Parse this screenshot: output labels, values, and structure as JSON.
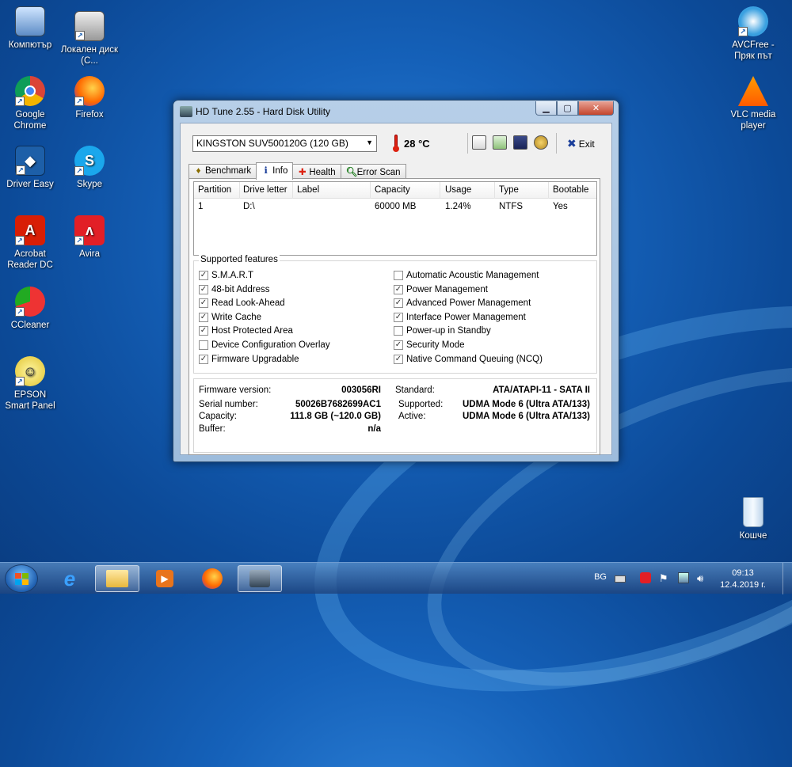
{
  "desktop_icons": [
    {
      "label": "Компютър"
    },
    {
      "label": "Локален диск (C..."
    },
    {
      "label": "Google Chrome"
    },
    {
      "label": "Firefox"
    },
    {
      "label": "Driver Easy"
    },
    {
      "label": "Skype"
    },
    {
      "label": "Acrobat Reader DC"
    },
    {
      "label": "Avira"
    },
    {
      "label": "CCleaner"
    },
    {
      "label": "EPSON Smart Panel"
    },
    {
      "label": "AVCFree - Пряк път"
    },
    {
      "label": "VLC media player"
    },
    {
      "label": "Кошче"
    }
  ],
  "window": {
    "title": "HD Tune 2.55 - Hard Disk Utility",
    "drive": "KINGSTON SUV500120G (120 GB)",
    "temperature": "28 °C",
    "exit_label": "Exit"
  },
  "tabs": [
    {
      "label": "Benchmark",
      "icon": "benchmark-icon"
    },
    {
      "label": "Info",
      "icon": "info-icon",
      "active": true
    },
    {
      "label": "Health",
      "icon": "health-icon"
    },
    {
      "label": "Error Scan",
      "icon": "error-scan-icon"
    }
  ],
  "partition_table": {
    "columns": [
      "Partition",
      "Drive letter",
      "Label",
      "Capacity",
      "Usage",
      "Type",
      "Bootable"
    ],
    "rows": [
      [
        "1",
        "D:\\",
        "",
        "60000 MB",
        "1.24%",
        "NTFS",
        "Yes"
      ]
    ]
  },
  "features": {
    "title": "Supported features",
    "left": [
      {
        "label": "S.M.A.R.T",
        "checked": true
      },
      {
        "label": "48-bit Address",
        "checked": true
      },
      {
        "label": "Read Look-Ahead",
        "checked": true
      },
      {
        "label": "Write Cache",
        "checked": true
      },
      {
        "label": "Host Protected Area",
        "checked": true
      },
      {
        "label": "Device Configuration Overlay",
        "checked": false
      },
      {
        "label": "Firmware Upgradable",
        "checked": true
      }
    ],
    "right": [
      {
        "label": "Automatic Acoustic Management",
        "checked": false
      },
      {
        "label": "Power Management",
        "checked": true
      },
      {
        "label": "Advanced Power Management",
        "checked": true
      },
      {
        "label": "Interface Power Management",
        "checked": true
      },
      {
        "label": "Power-up in Standby",
        "checked": false
      },
      {
        "label": "Security Mode",
        "checked": true
      },
      {
        "label": "Native Command Queuing (NCQ)",
        "checked": true
      }
    ]
  },
  "specs": {
    "firmware_label": "Firmware version:",
    "firmware": "003056RI",
    "serial_label": "Serial number:",
    "serial": "50026B7682699AC1",
    "capacity_label": "Capacity:",
    "capacity": "111.8 GB (~120.0 GB)",
    "buffer_label": "Buffer:",
    "buffer": "n/a",
    "standard_label": "Standard:",
    "standard": "ATA/ATAPI-11 - SATA II",
    "supported_label": "Supported:",
    "supported": "UDMA Mode 6 (Ultra ATA/133)",
    "active_label": "Active:",
    "active": "UDMA Mode 6 (Ultra ATA/133)"
  },
  "taskbar": {
    "language": "BG",
    "time": "09:13",
    "date": "12.4.2019 г."
  }
}
